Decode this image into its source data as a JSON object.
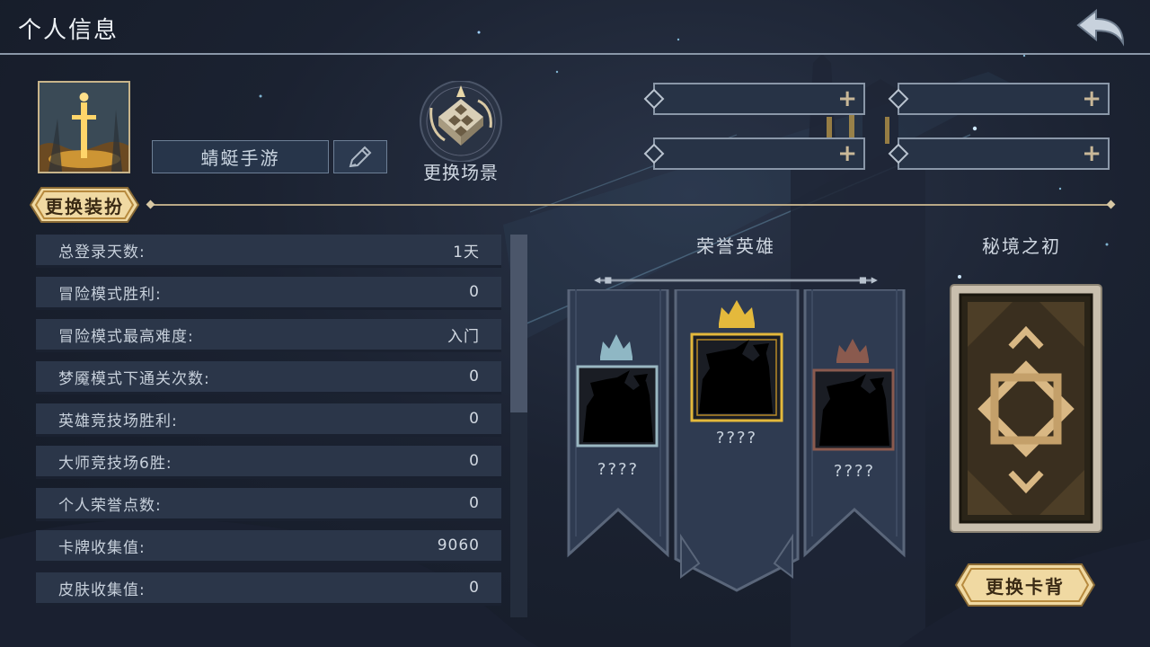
{
  "header": {
    "title": "个人信息"
  },
  "profile": {
    "name": "蜻蜓手游"
  },
  "scene": {
    "label": "更换场景"
  },
  "dress_button": {
    "label": "更换装扮"
  },
  "stats": [
    {
      "label": "总登录天数:",
      "value": "1天"
    },
    {
      "label": "冒险模式胜利:",
      "value": "0"
    },
    {
      "label": "冒险模式最高难度:",
      "value": "入门"
    },
    {
      "label": "梦魇模式下通关次数:",
      "value": "0"
    },
    {
      "label": "英雄竞技场胜利:",
      "value": "0"
    },
    {
      "label": "大师竞技场6胜:",
      "value": "0"
    },
    {
      "label": "个人荣誉点数:",
      "value": "0"
    },
    {
      "label": "卡牌收集值:",
      "value": "9060"
    },
    {
      "label": "皮肤收集值:",
      "value": "0"
    }
  ],
  "honor": {
    "title": "荣誉英雄",
    "heroes": [
      {
        "name": "????",
        "rank": "silver",
        "frame_color": "#9ab7c2"
      },
      {
        "name": "????",
        "rank": "gold",
        "frame_color": "#e4b93c"
      },
      {
        "name": "????",
        "rank": "bronze",
        "frame_color": "#8a5a4e"
      }
    ]
  },
  "card_back": {
    "title": "秘境之初",
    "button_label": "更换卡背"
  },
  "colors": {
    "background": "#1b2231",
    "panel_row": "#2b3649",
    "gold": "#e8c98a",
    "accent_line": "#b9a886"
  }
}
